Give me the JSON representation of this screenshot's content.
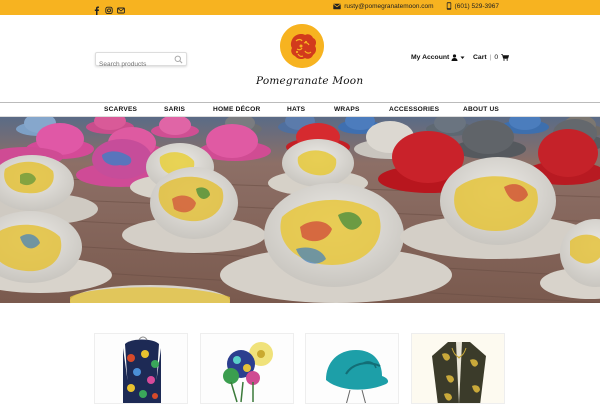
{
  "topbar": {
    "social": [
      "facebook-icon",
      "instagram-icon",
      "envelope-icon"
    ],
    "email": "rusty@pomegranatemoon.com",
    "phone": "(601) 529-3967"
  },
  "search": {
    "placeholder": "Search products"
  },
  "brand": {
    "name": "Pomegranate Moon"
  },
  "account": {
    "label": "My Account"
  },
  "cart": {
    "label": "Cart",
    "count": "0"
  },
  "nav": {
    "items": [
      "SCARVES",
      "SARIS",
      "HOME DÉCOR",
      "HATS",
      "WRAPS",
      "ACCESSORIES",
      "ABOUT US"
    ]
  },
  "hero": {
    "subject": "rows-of-felted-wool-hats"
  },
  "products": {
    "cards": [
      {
        "name": "scarf-product-image"
      },
      {
        "name": "felt-flowers-product-image"
      },
      {
        "name": "teal-hat-product-image"
      },
      {
        "name": "kimono-wrap-product-image"
      }
    ]
  },
  "colors": {
    "accent": "#f7b320",
    "text": "#111111"
  }
}
